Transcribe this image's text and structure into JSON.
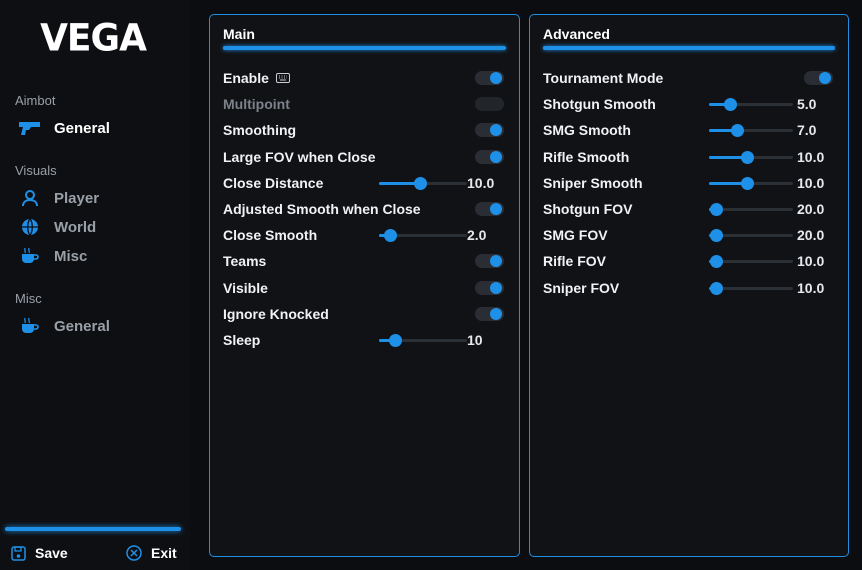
{
  "app": {
    "logo": "VEGA"
  },
  "colors": {
    "accent": "#1e90e8",
    "background": "#0c0d10",
    "panel": "#111216"
  },
  "sidebar": {
    "sections": [
      {
        "title": "Aimbot",
        "items": [
          {
            "label": "General",
            "icon": "gun-icon",
            "active": true
          }
        ]
      },
      {
        "title": "Visuals",
        "items": [
          {
            "label": "Player",
            "icon": "user-icon",
            "active": false
          },
          {
            "label": "World",
            "icon": "globe-icon",
            "active": false
          },
          {
            "label": "Misc",
            "icon": "cup-icon",
            "active": false
          }
        ]
      },
      {
        "title": "Misc",
        "items": [
          {
            "label": "General",
            "icon": "cup-icon",
            "active": false
          }
        ]
      }
    ],
    "save_label": "Save",
    "exit_label": "Exit"
  },
  "main": {
    "title": "Main",
    "rows": [
      {
        "label": "Enable",
        "control": "toggle",
        "on": true,
        "icon": "keyboard-icon"
      },
      {
        "label": "Multipoint",
        "control": "toggle",
        "on": false
      },
      {
        "label": "Smoothing",
        "control": "toggle",
        "on": true
      },
      {
        "label": "Large FOV when Close",
        "control": "toggle",
        "on": true
      },
      {
        "label": "Close Distance",
        "control": "slider",
        "value": "10.0",
        "fraction": 0.47
      },
      {
        "label": "Adjusted Smooth when Close",
        "control": "toggle",
        "on": true
      },
      {
        "label": "Close Smooth",
        "control": "slider",
        "value": "2.0",
        "fraction": 0.13
      },
      {
        "label": "Teams",
        "control": "toggle",
        "on": true
      },
      {
        "label": "Visible",
        "control": "toggle",
        "on": true
      },
      {
        "label": "Ignore Knocked",
        "control": "toggle",
        "on": true
      },
      {
        "label": "Sleep",
        "control": "slider",
        "value": "10",
        "fraction": 0.18
      }
    ]
  },
  "advanced": {
    "title": "Advanced",
    "rows": [
      {
        "label": "Tournament Mode",
        "control": "toggle",
        "on": true
      },
      {
        "label": "Shotgun Smooth",
        "control": "slider",
        "value": "5.0",
        "fraction": 0.25
      },
      {
        "label": "SMG Smooth",
        "control": "slider",
        "value": "7.0",
        "fraction": 0.33
      },
      {
        "label": "Rifle Smooth",
        "control": "slider",
        "value": "10.0",
        "fraction": 0.45
      },
      {
        "label": "Sniper Smooth",
        "control": "slider",
        "value": "10.0",
        "fraction": 0.45
      },
      {
        "label": "Shotgun FOV",
        "control": "slider",
        "value": "20.0",
        "fraction": 0.08
      },
      {
        "label": "SMG FOV",
        "control": "slider",
        "value": "20.0",
        "fraction": 0.08
      },
      {
        "label": "Rifle FOV",
        "control": "slider",
        "value": "10.0",
        "fraction": 0.08
      },
      {
        "label": "Sniper FOV",
        "control": "slider",
        "value": "10.0",
        "fraction": 0.08
      }
    ]
  }
}
